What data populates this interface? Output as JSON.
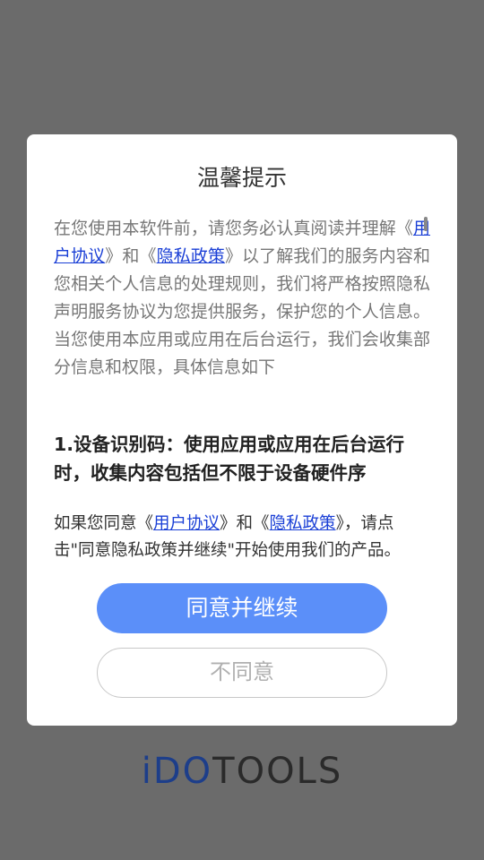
{
  "dialog": {
    "title": "温馨提示",
    "intro": {
      "text_before": "在您使用本软件前，请您务必认真阅读并理解《",
      "link1": "用户协议",
      "text_mid": "》和《",
      "link2": "隐私政策",
      "text_after": "》以了解我们的服务内容和您相关个人信息的处理规则，我们将严格按照隐私声明服务协议为您提供服务，保护您的个人信息。当您使用本应用或应用在后台运行，我们会收集部分信息和权限，具体信息如下"
    },
    "item": "1.设备识别码：使用应用或应用在后台运行时，收集内容包括但不限于设备硬件序",
    "consent": {
      "text_before": "如果您同意《",
      "link1": "用户协议",
      "text_mid": "》和《",
      "link2": "隐私政策",
      "text_after": "》，请点击\"同意隐私政策并继续\"开始使用我们的产品。"
    },
    "agree_button": "同意并继续",
    "disagree_button": "不同意"
  },
  "logo": {
    "part1": "iDO",
    "part2": "TOOLS"
  },
  "colors": {
    "overlay": "#6b6b6b",
    "accent": "#5b8ff9",
    "link": "#1a3fd6"
  }
}
